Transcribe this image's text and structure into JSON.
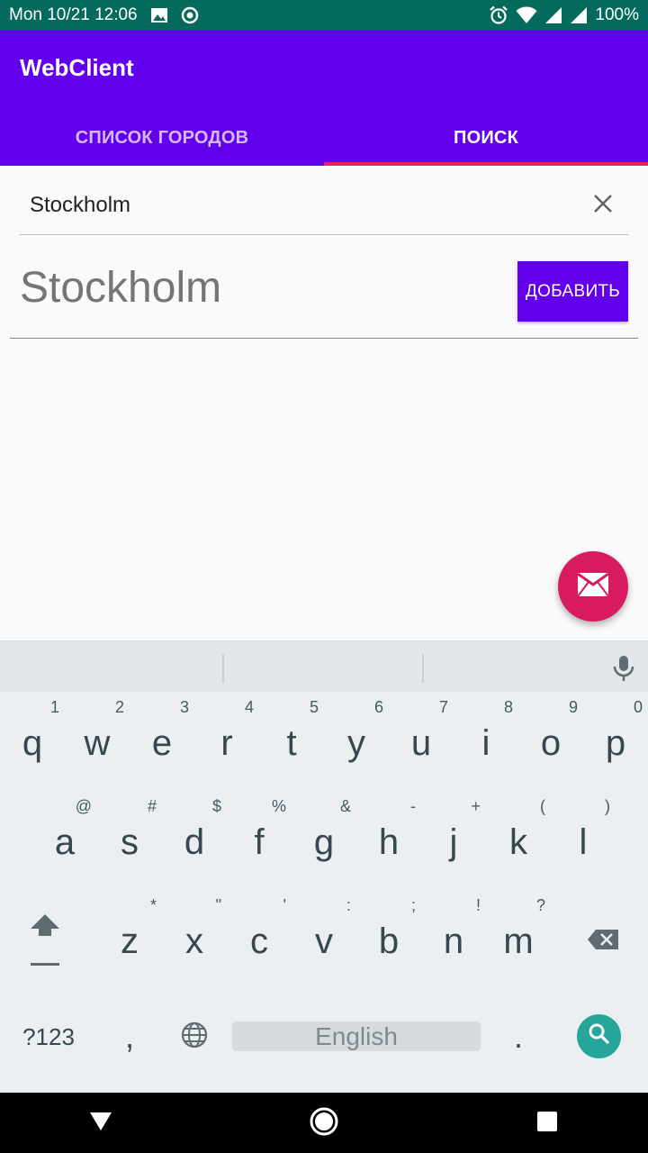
{
  "status_bar": {
    "time": "Mon 10/21 12:06",
    "battery": "100%",
    "icons": [
      "image-icon",
      "circle-dot-icon",
      "alarm-icon",
      "wifi-icon",
      "signal-icon",
      "signal-icon",
      "battery-icon"
    ]
  },
  "app_bar": {
    "title": "WebClient",
    "tabs": [
      {
        "label": "СПИСОК ГОРОДОВ",
        "active": false
      },
      {
        "label": "ПОИСК",
        "active": true
      }
    ]
  },
  "search": {
    "value": "Stockholm",
    "clear_icon": "close-icon"
  },
  "result": {
    "name": "Stockholm",
    "add_label": "ДОБАВИТЬ"
  },
  "fab": {
    "icon": "mail-icon"
  },
  "keyboard": {
    "row1": [
      {
        "key": "q",
        "hint": "1"
      },
      {
        "key": "w",
        "hint": "2"
      },
      {
        "key": "e",
        "hint": "3"
      },
      {
        "key": "r",
        "hint": "4"
      },
      {
        "key": "t",
        "hint": "5"
      },
      {
        "key": "y",
        "hint": "6"
      },
      {
        "key": "u",
        "hint": "7"
      },
      {
        "key": "i",
        "hint": "8"
      },
      {
        "key": "o",
        "hint": "9"
      },
      {
        "key": "p",
        "hint": "0"
      }
    ],
    "row2": [
      {
        "key": "a",
        "hint": "@"
      },
      {
        "key": "s",
        "hint": "#"
      },
      {
        "key": "d",
        "hint": "$"
      },
      {
        "key": "f",
        "hint": "%"
      },
      {
        "key": "g",
        "hint": "&"
      },
      {
        "key": "h",
        "hint": "-"
      },
      {
        "key": "j",
        "hint": "+"
      },
      {
        "key": "k",
        "hint": "("
      },
      {
        "key": "l",
        "hint": ")"
      }
    ],
    "row3": [
      {
        "key": "z",
        "hint": "*"
      },
      {
        "key": "x",
        "hint": "\""
      },
      {
        "key": "c",
        "hint": "'"
      },
      {
        "key": "v",
        "hint": ":"
      },
      {
        "key": "b",
        "hint": ";"
      },
      {
        "key": "n",
        "hint": "!"
      },
      {
        "key": "m",
        "hint": "?"
      }
    ],
    "symbols_label": "?123",
    "comma": ",",
    "space_label": "English",
    "period": ".",
    "accent": "#26a69a"
  },
  "colors": {
    "primary": "#6200ee",
    "accent": "#e91e63",
    "status_bar": "#046b5c"
  }
}
